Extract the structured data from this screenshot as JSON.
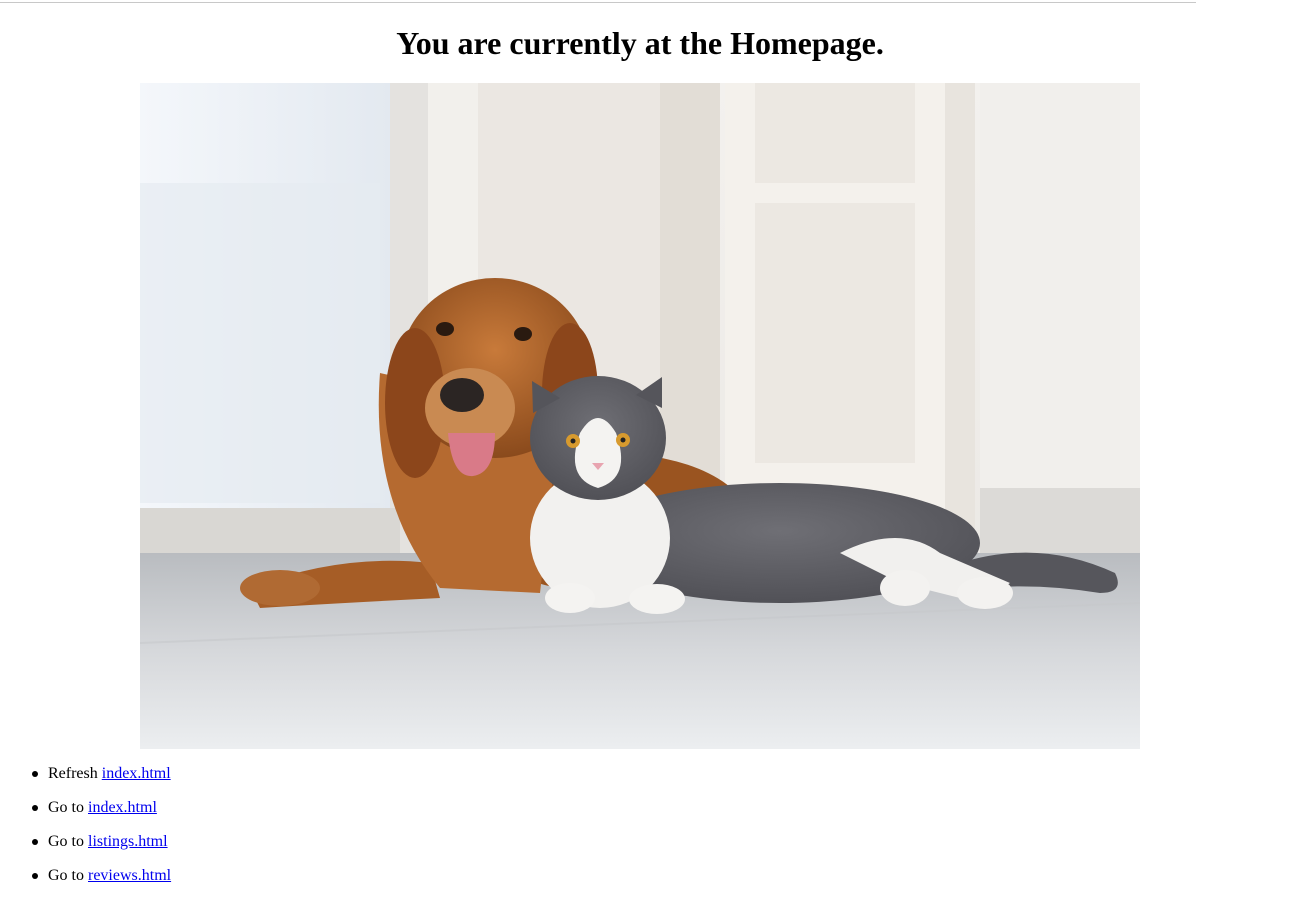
{
  "page": {
    "title": "You are currently at the Homepage."
  },
  "hero_image": {
    "alt": "Golden retriever dog and grey-and-white cat lying together on a floor"
  },
  "nav": {
    "items": [
      {
        "prefix": "Refresh ",
        "link": "index.html"
      },
      {
        "prefix": "Go to ",
        "link": "index.html"
      },
      {
        "prefix": "Go to ",
        "link": "listings.html"
      },
      {
        "prefix": "Go to ",
        "link": "reviews.html"
      }
    ]
  },
  "colors": {
    "link": "#0000ee",
    "text": "#000000",
    "background": "#ffffff"
  }
}
